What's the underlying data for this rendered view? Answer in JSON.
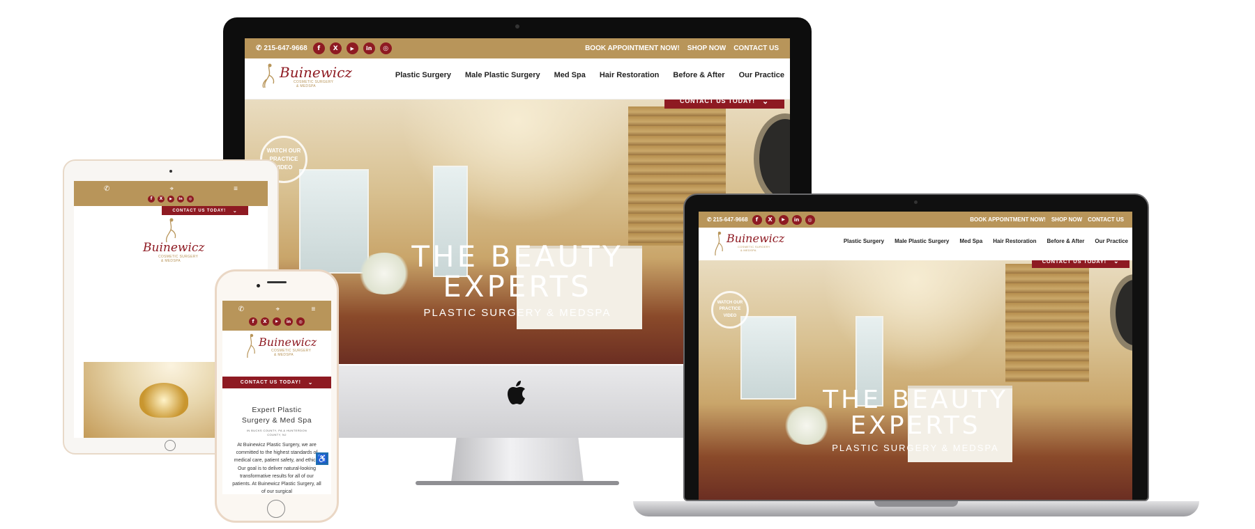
{
  "site": {
    "phone": "215-647-9668",
    "social_icons": [
      "facebook-icon",
      "x-icon",
      "youtube-icon",
      "linkedin-icon",
      "instagram-icon"
    ],
    "social_glyphs": [
      "f",
      "X",
      "▶",
      "in",
      "◎"
    ],
    "top_links": [
      "BOOK APPOINTMENT NOW!",
      "SHOP NOW",
      "CONTACT US"
    ],
    "logo_name": "Buinewicz",
    "logo_sub": "COSMETIC SURGERY",
    "logo_sub2": "& MEDSPA",
    "nav": [
      "Plastic Surgery",
      "Male Plastic Surgery",
      "Med Spa",
      "Hair Restoration",
      "Before & After",
      "Our Practice"
    ],
    "cta": "CONTACT US TODAY!",
    "cta_arrow": "⌄",
    "video_line1": "WATCH OUR",
    "video_line2": "PRACTICE",
    "video_line3": "VIDEO",
    "hero_line1": "THE BEAUTY",
    "hero_line2": "EXPERTS",
    "hero_sub": "PLASTIC SURGERY & MEDSPA"
  },
  "mobile": {
    "heading_line1": "Expert Plastic",
    "heading_line2": "Surgery & Med Spa",
    "location": "IN BUCKS COUNTY, PA & HUNTERDON COUNTY, NJ",
    "body": "At Buinewicz Plastic Surgery, we are committed to the highest standards of medical care, patient safety, and ethics. Our goal is to deliver natural-looking transformative results for all of our patients. At Buinewicz Plastic Surgery, all of our surgical",
    "phone_icon": "✆",
    "pin_icon": "⌖",
    "menu_icon": "≡",
    "accessibility_icon": "♿"
  },
  "colors": {
    "gold": "#b8955a",
    "maroon": "#8e1a22"
  }
}
